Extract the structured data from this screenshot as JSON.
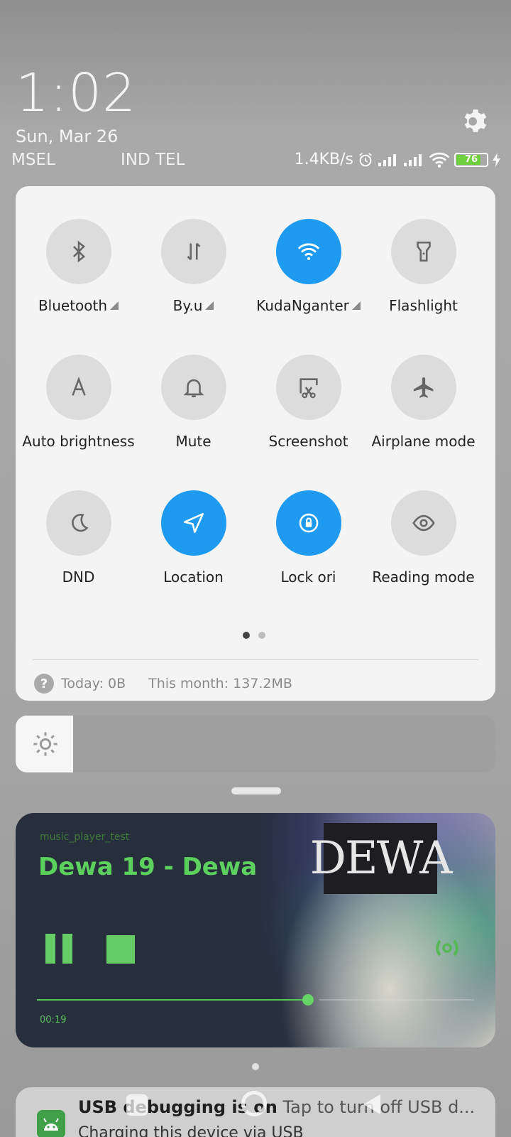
{
  "status": {
    "time": "1:02",
    "date": "Sun, Mar 26",
    "carrier1": "MSEL",
    "carrier2": "IND TEL",
    "net_speed": "1.4KB/s",
    "battery": "76"
  },
  "quick_settings": {
    "tiles": [
      {
        "label": "Bluetooth",
        "icon": "bluetooth-icon",
        "on": false,
        "expand": true
      },
      {
        "label": "By.u",
        "icon": "mobile-data-icon",
        "on": false,
        "expand": true
      },
      {
        "label": "KudaNganter",
        "icon": "wifi-icon",
        "on": true,
        "expand": true
      },
      {
        "label": "Flashlight",
        "icon": "flashlight-icon",
        "on": false,
        "expand": false
      },
      {
        "label": "Auto brightness",
        "icon": "auto-brightness-icon",
        "on": false,
        "expand": false
      },
      {
        "label": "Mute",
        "icon": "bell-icon",
        "on": false,
        "expand": false
      },
      {
        "label": "Screenshot",
        "icon": "screenshot-icon",
        "on": false,
        "expand": false
      },
      {
        "label": "Airplane mode",
        "icon": "airplane-icon",
        "on": false,
        "expand": false
      },
      {
        "label": "DND",
        "icon": "moon-icon",
        "on": false,
        "expand": false
      },
      {
        "label": "Location",
        "icon": "location-icon",
        "on": true,
        "expand": false
      },
      {
        "label": "Lock ori",
        "icon": "rotation-lock-icon",
        "on": true,
        "expand": false
      },
      {
        "label": "Reading mode",
        "icon": "eye-icon",
        "on": false,
        "expand": false
      }
    ],
    "page_current": 1,
    "page_total": 2,
    "data_today": "Today: 0B",
    "data_month": "This month: 137.2MB",
    "colors": {
      "active": "#1e9bf0",
      "inactive": "#dcdcdc"
    }
  },
  "brightness": {
    "level": 0.12
  },
  "media": {
    "app": "music_player_test",
    "title": "Dewa 19 - Dewa",
    "elapsed": "00:19",
    "progress": 0.62,
    "album_text": "DEWA",
    "accent": "#66cc66"
  },
  "notification": {
    "title": "USB debugging is on",
    "body": "Tap to turn off USB d...",
    "line2": "Charging this device via USB"
  }
}
